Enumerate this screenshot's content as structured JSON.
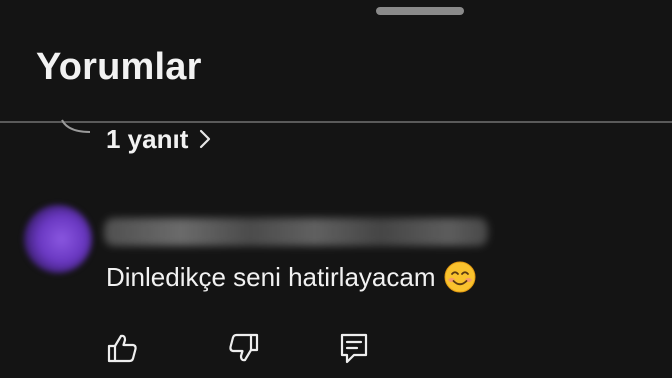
{
  "header": {
    "title": "Yorumlar"
  },
  "replies": {
    "label": "1 yanıt"
  },
  "comment": {
    "author": "",
    "text": "Dinledikçe seni hatirlayacam",
    "emoji": "😊"
  },
  "actions": {
    "like_icon": "thumbs-up-icon",
    "dislike_icon": "thumbs-down-icon",
    "reply_icon": "reply-comment-icon"
  },
  "colors": {
    "background": "#141414",
    "text": "#f1f1f1",
    "avatar_accent": "#7b4ad6"
  }
}
